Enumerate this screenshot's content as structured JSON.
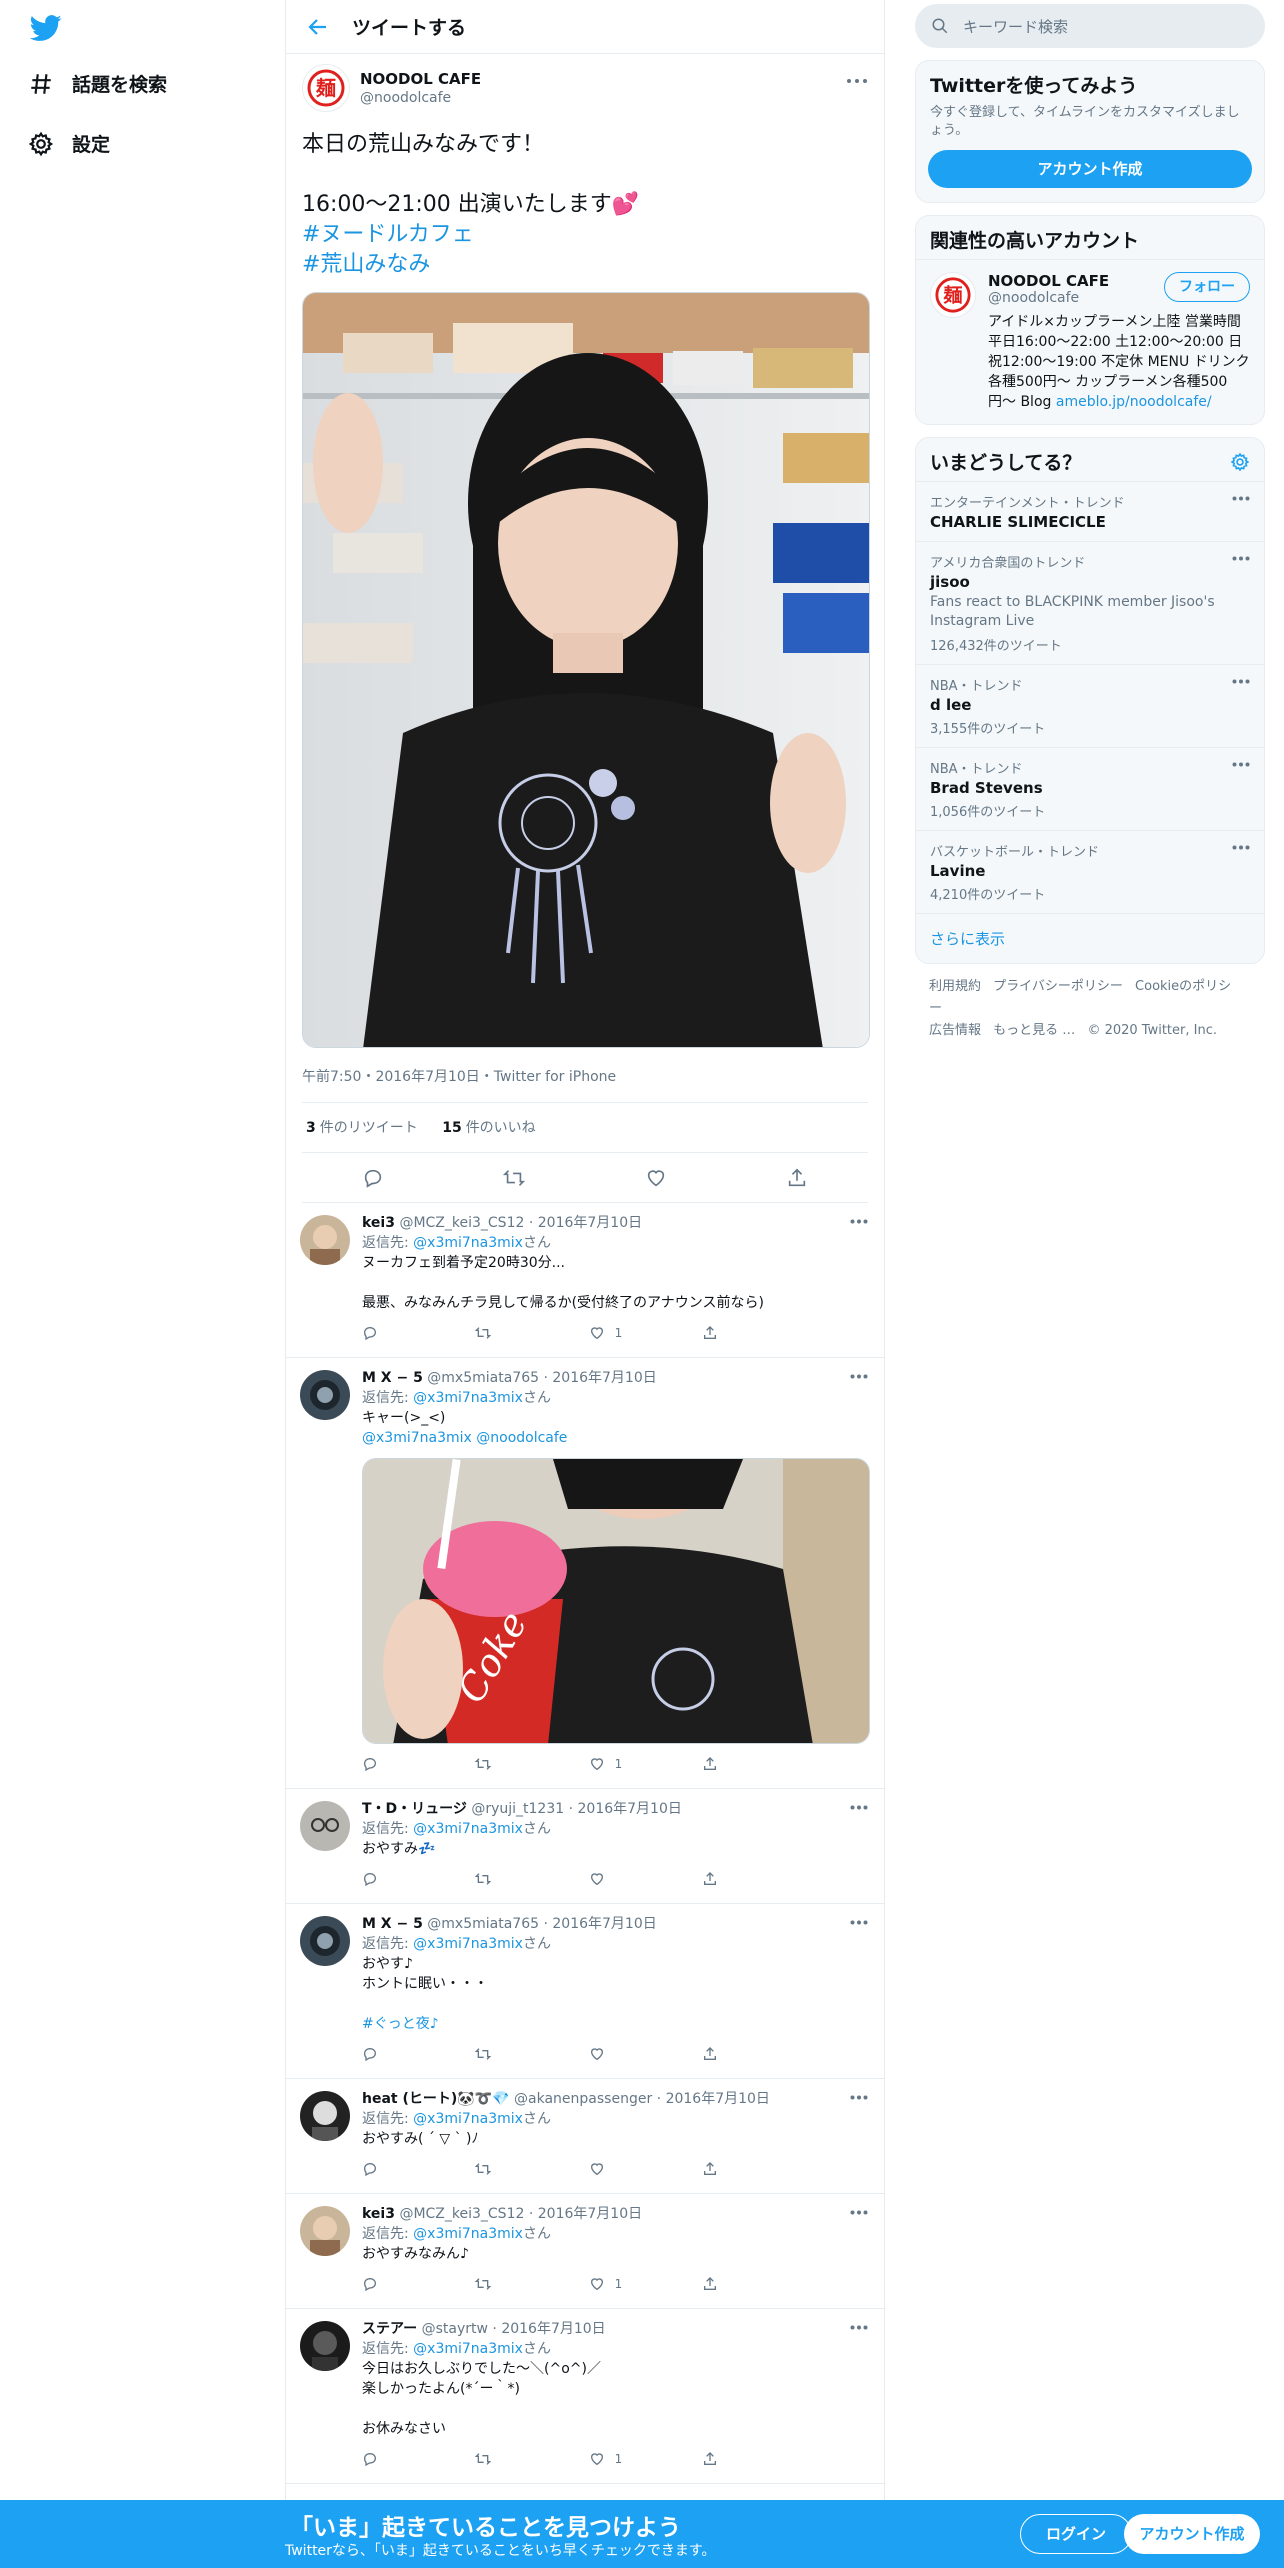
{
  "nav": {
    "explore_label": "話題を検索",
    "settings_label": "設定"
  },
  "header": {
    "title": "ツイートする"
  },
  "tweet": {
    "name": "NOODOL CAFE",
    "handle": "@noodolcafe",
    "lines": [
      "本日の荒山みなみです！",
      "",
      "16:00〜21:00 出演いたします💕",
      "#ヌードルカフェ",
      "#荒山みなみ"
    ],
    "meta": "午前7:50・2016年7月10日・Twitter for iPhone",
    "retweets": "3",
    "retweets_label": "件のリツイート",
    "likes": "15",
    "likes_label": "件のいいね"
  },
  "replies": [
    {
      "name": "kei3",
      "handle": "@MCZ_kei3_CS12",
      "date": "2016年7月10日",
      "to_prefix": "返信先: ",
      "to_user": "@x3mi7na3mix",
      "to_suffix": "さん",
      "lines": [
        "ヌーカフェ到着予定20時30分...",
        "",
        "最悪、みなみんチラ見して帰るか(受付終了のアナウンス前なら)"
      ],
      "likes": "1"
    },
    {
      "name": "M X − 5",
      "handle": "@mx5miata765",
      "date": "2016年7月10日",
      "to_prefix": "返信先: ",
      "to_user": "@x3mi7na3mix",
      "to_suffix": "さん",
      "lines": [
        "キャー(>_<)",
        "@x3mi7na3mix @noodolcafe"
      ],
      "likes": "1"
    },
    {
      "name": "T・D・リュージ",
      "handle": "@ryuji_t1231",
      "date": "2016年7月10日",
      "to_prefix": "返信先: ",
      "to_user": "@x3mi7na3mix",
      "to_suffix": "さん",
      "lines": [
        "おやすみ💤"
      ],
      "likes": ""
    },
    {
      "name": "M X − 5",
      "handle": "@mx5miata765",
      "date": "2016年7月10日",
      "to_prefix": "返信先: ",
      "to_user": "@x3mi7na3mix",
      "to_suffix": "さん",
      "lines": [
        "おやす♪",
        "ホントに眠い・・・",
        "",
        "#ぐっと夜♪"
      ],
      "likes": ""
    },
    {
      "name": "heat (ヒート)🐼➰💎",
      "handle": "@akanenpassenger",
      "date": "2016年7月10日",
      "to_prefix": "返信先: ",
      "to_user": "@x3mi7na3mix",
      "to_suffix": "さん",
      "lines": [
        "おやすみ( ´ ▽ ` )ﾉ"
      ],
      "likes": ""
    },
    {
      "name": "kei3",
      "handle": "@MCZ_kei3_CS12",
      "date": "2016年7月10日",
      "to_prefix": "返信先: ",
      "to_user": "@x3mi7na3mix",
      "to_suffix": "さん",
      "lines": [
        "おやすみなみん♪"
      ],
      "likes": "1"
    },
    {
      "name": "ステアー",
      "handle": "@stayrtw",
      "date": "2016年7月10日",
      "to_prefix": "返信先: ",
      "to_user": "@x3mi7na3mix",
      "to_suffix": "さん",
      "lines": [
        "今日はお久しぶりでした〜＼(^o^)／",
        "楽しかったよん(*´ー｀*)",
        "",
        "お休みなさい"
      ],
      "likes": "1"
    }
  ],
  "sidebar": {
    "search_placeholder": "キーワード検索",
    "signup_card": {
      "title": "Twitterを使ってみよう",
      "subtitle": "今すぐ登録して、タイムラインをカスタマイズしましょう。",
      "button": "アカウント作成"
    },
    "related": {
      "title": "関連性の高いアカウント",
      "name": "NOODOL CAFE",
      "handle": "@noodolcafe",
      "follow": "フォロー",
      "bio": "アイドル×カップラーメン上陸 営業時間 平日16:00〜22:00 土12:00〜20:00 日祝12:00〜19:00 不定休 MENU ドリンク各種500円〜 カップラーメン各種500円〜 Blog ",
      "bio_link": "ameblo.jp/noodolcafe/"
    },
    "trends": {
      "title": "いまどうしてる？",
      "items": [
        {
          "context": "エンターテインメント・トレンド",
          "title": "CHARLIE SLIMECICLE",
          "desc": "",
          "count": ""
        },
        {
          "context": "アメリカ合衆国のトレンド",
          "title": "jisoo",
          "desc": "Fans react to BLACKPINK member Jisoo's Instagram Live",
          "count": "126,432件のツイート"
        },
        {
          "context": "NBA・トレンド",
          "title": "d lee",
          "desc": "",
          "count": "3,155件のツイート"
        },
        {
          "context": "NBA・トレンド",
          "title": "Brad Stevens",
          "desc": "",
          "count": "1,056件のツイート"
        },
        {
          "context": "バスケットボール・トレンド",
          "title": "Lavine",
          "desc": "",
          "count": "4,210件のツイート"
        }
      ],
      "show_more": "さらに表示"
    },
    "footer": [
      "利用規約",
      "プライバシーポリシー",
      "Cookieのポリシー",
      "広告情報",
      "もっと見る …",
      "© 2020 Twitter, Inc."
    ]
  },
  "bottom_bar": {
    "title": "「いま」起きていることを見つけよう",
    "subtitle": "Twitterなら、「いま」起きていることをいち早くチェックできます。",
    "login": "ログイン",
    "signup": "アカウント作成"
  },
  "colors": {
    "accent": "#1da1f2",
    "link": "#1b95e0",
    "secondary_text": "#657786",
    "border": "#e6ecf0"
  }
}
